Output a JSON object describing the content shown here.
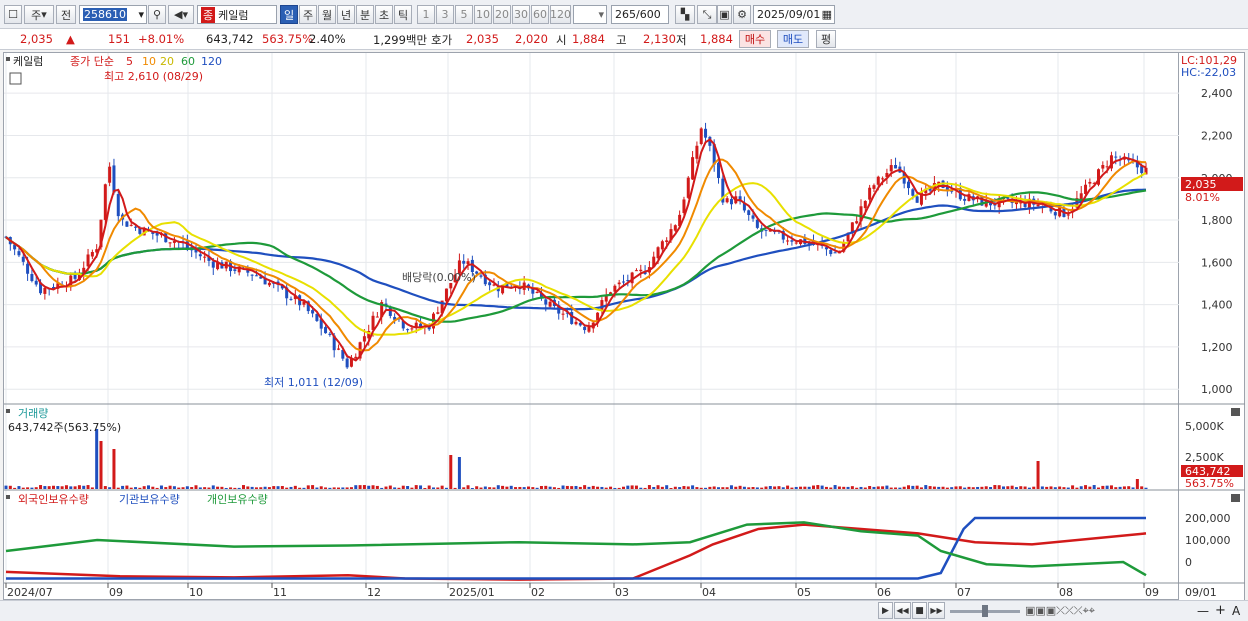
{
  "toolbar": {
    "type_label": "주",
    "prev_label": "전",
    "code_value": "258610",
    "market_tag": "종",
    "stock_name": "케일럼",
    "period_buttons": [
      "일",
      "주",
      "월",
      "년",
      "분",
      "초",
      "틱"
    ],
    "interval_buttons": [
      "1",
      "3",
      "5",
      "10",
      "20",
      "30",
      "60",
      "120"
    ],
    "bar_count": "265",
    "bar_total": "/600",
    "date_value": "2025/09/01"
  },
  "quote": {
    "price": "2,035",
    "change_arrow": "▲",
    "change": "151",
    "change_pct": "+8.01%",
    "volume": "643,742",
    "volume_ratio": "563.75%",
    "turnover": "2.40%",
    "amount": "1,299백만",
    "ask_label": "호가",
    "ask": "2,035",
    "bid": "2,020",
    "open_label": "시",
    "open": "1,884",
    "high_label": "고",
    "high": "2,130",
    "low_label": "저",
    "low": "1,884",
    "buy_label": "매수",
    "sell_label": "매도",
    "extra_label": "평"
  },
  "chart_data": {
    "type": "candlestick",
    "price_legend": [
      "케일럼",
      "종가 단순",
      "5",
      "10",
      "20",
      "60",
      "120"
    ],
    "legend_colors": {
      "5": "#d21a1a",
      "10": "#f08a00",
      "20": "#e8e000",
      "60": "#1e9a3a",
      "120": "#1f4fbf"
    },
    "lc_label": "LC:101,29",
    "hc_label": "HC:-22,03",
    "price_ticks": [
      "2,400",
      "2,200",
      "2,000",
      "1,800",
      "1,600",
      "1,400",
      "1,200",
      "1,000"
    ],
    "price_tick_values": [
      2400,
      2200,
      2000,
      1800,
      1600,
      1400,
      1200,
      1000
    ],
    "price_ylim": [
      930,
      2590
    ],
    "current_price_tag": "2,035",
    "current_pct_tag": "8.01%",
    "high_annotation": "최고 2,610 (08/29)",
    "low_annotation": "최저 1,011 (12/09)",
    "dividend_annotation": "배당락(0.00%)",
    "volume_title": "거래량",
    "volume_readout": "643,742주(563.75%)",
    "volume_ticks": [
      "5,000K",
      "2,500K"
    ],
    "volume_tag": "643,742",
    "volume_pct_tag": "563.75%",
    "holding_legend": [
      "외국인보유수량",
      "기관보유수량",
      "개인보유수량"
    ],
    "holding_colors": [
      "#d21a1a",
      "#1f4fbf",
      "#1e9a3a"
    ],
    "holding_ticks": [
      "200,000",
      "100,000",
      "0"
    ],
    "x_labels": [
      "2024/07",
      "09",
      "10",
      "11",
      "12",
      "2025/01",
      "02",
      "03",
      "04",
      "05",
      "06",
      "07",
      "08",
      "09",
      "09/01"
    ],
    "price_path_x": [
      0,
      0.03,
      0.06,
      0.08,
      0.09,
      0.1,
      0.12,
      0.15,
      0.18,
      0.22,
      0.26,
      0.28,
      0.3,
      0.33,
      0.35,
      0.37,
      0.4,
      0.43,
      0.45,
      0.48,
      0.51,
      0.53,
      0.56,
      0.59,
      0.61,
      0.62,
      0.63,
      0.64,
      0.66,
      0.68,
      0.7,
      0.73,
      0.76,
      0.78,
      0.8,
      0.82,
      0.84,
      0.86,
      0.9,
      0.93,
      0.97,
      1.0
    ],
    "price_path_y": [
      1720,
      1470,
      1520,
      1680,
      2080,
      1800,
      1750,
      1700,
      1600,
      1540,
      1400,
      1270,
      1110,
      1410,
      1300,
      1290,
      1610,
      1480,
      1500,
      1380,
      1290,
      1470,
      1560,
      1810,
      2240,
      2100,
      1880,
      1900,
      1750,
      1720,
      1700,
      1640,
      1960,
      2060,
      1900,
      1970,
      1910,
      1880,
      1880,
      1830,
      2100,
      2035
    ]
  },
  "bottom": {
    "nav_buttons": [
      "▶",
      "◀◀",
      "■",
      "▶▶"
    ],
    "zoom_labels": [
      "—",
      "+",
      "A"
    ]
  }
}
